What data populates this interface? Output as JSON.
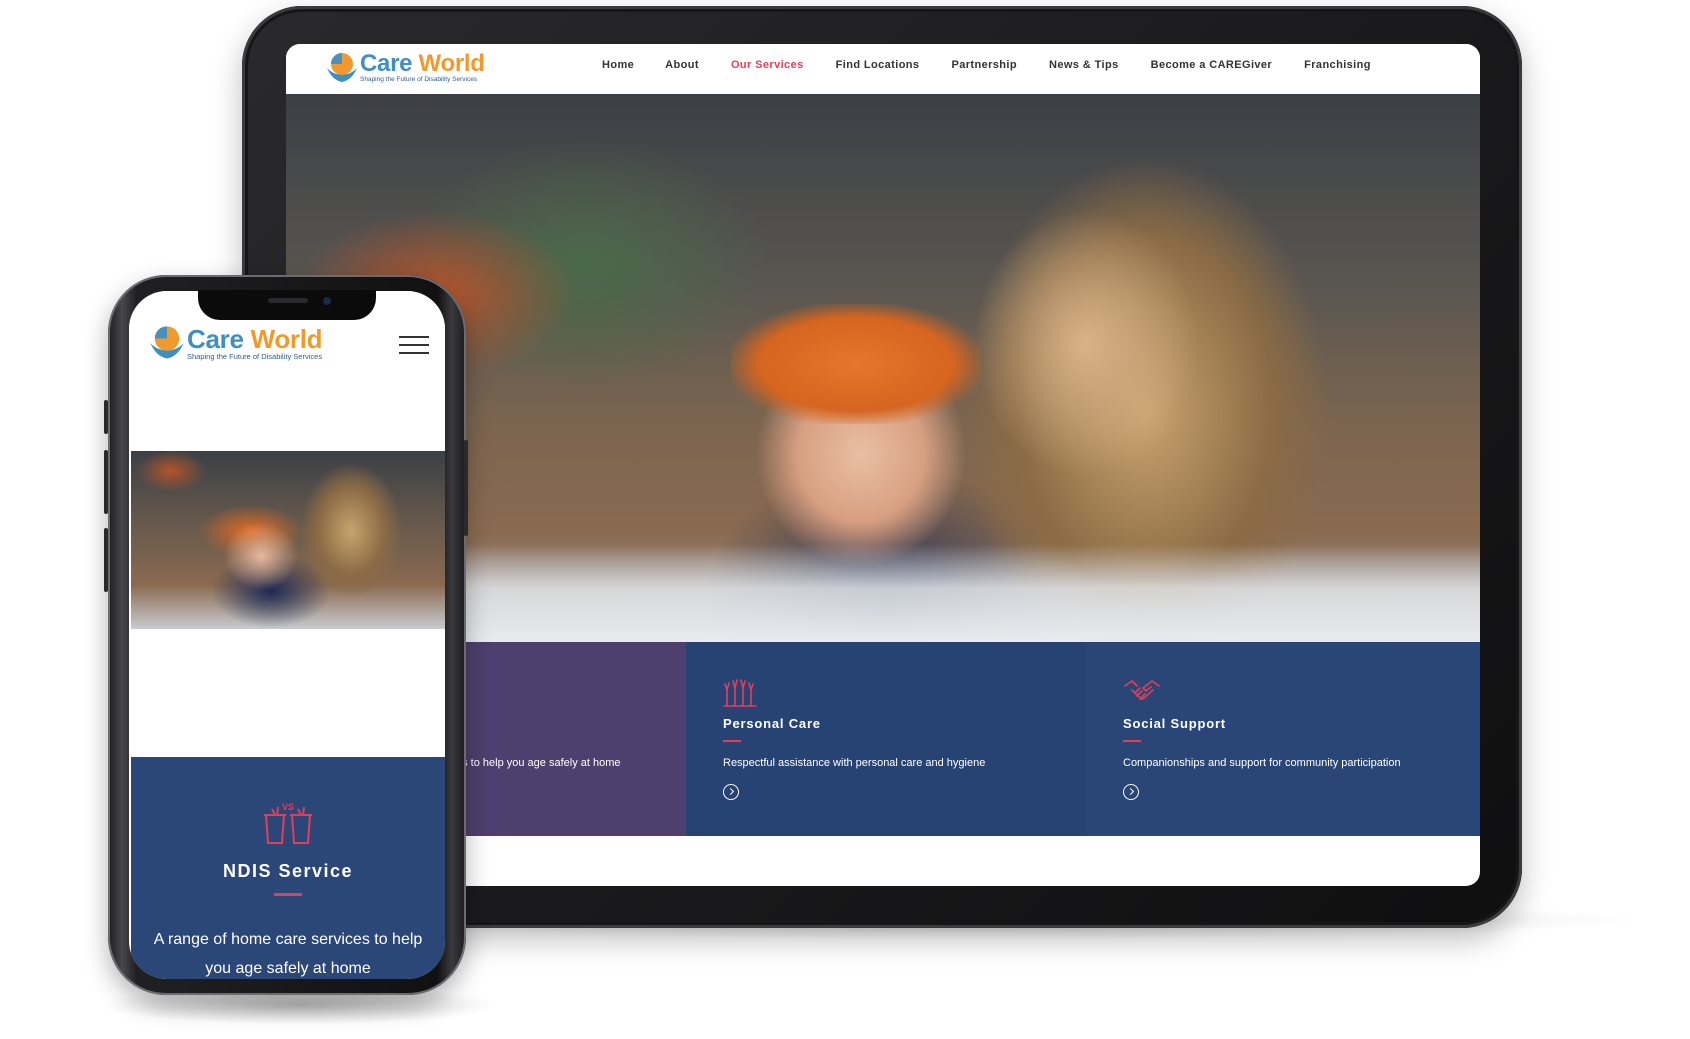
{
  "brand": {
    "name_part1": "Care",
    "name_part2": "World",
    "tagline": "Shaping the Future of Disability Services",
    "colors": {
      "blue": "#3f8fc2",
      "orange": "#f09a2e",
      "navy": "#2c5e8f"
    }
  },
  "tablet": {
    "nav": {
      "items": [
        {
          "label": "Home",
          "active": false
        },
        {
          "label": "About",
          "active": false
        },
        {
          "label": "Our Services",
          "active": true
        },
        {
          "label": "Find Locations",
          "active": false
        },
        {
          "label": "Partnership",
          "active": false
        },
        {
          "label": "News & Tips",
          "active": false
        },
        {
          "label": "Become a CAREGiver",
          "active": false
        },
        {
          "label": "Franchising",
          "active": false
        }
      ],
      "active_color": "#e43d59"
    },
    "cards": [
      {
        "title": "",
        "description": "es to help you age safely at home",
        "bg": "#4f3f6e",
        "icon": "none"
      },
      {
        "title": "Personal Care",
        "description": "Respectful assistance with personal care and hygiene",
        "bg": "#274373",
        "icon": "raised-hands-icon"
      },
      {
        "title": "Social Support",
        "description": "Companionships and support for community participation",
        "bg": "#2a4677",
        "icon": "handshake-icon"
      }
    ]
  },
  "phone": {
    "service": {
      "title": "NDIS Service",
      "description": "A range of home care services to help you age safely at home",
      "icon": "cups-vs-icon",
      "icon_text": "VS",
      "bg": "#2b4777"
    }
  }
}
